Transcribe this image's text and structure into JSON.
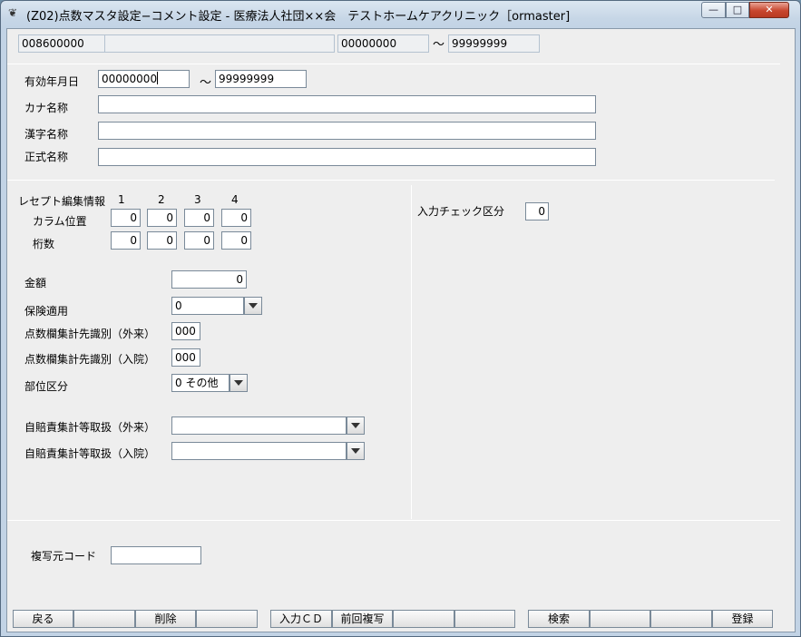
{
  "window": {
    "title": "(Z02)点数マスタ設定−コメント設定 - 医療法人社団××会　テストホームケアクリニック［ormaster]",
    "min_glyph": "—",
    "max_glyph": "□",
    "close_glyph": "✕"
  },
  "header": {
    "code": "008600000",
    "name": "",
    "range_from": "00000000",
    "tilde": "〜",
    "range_to": "99999999"
  },
  "form": {
    "valid_date_label": "有効年月日",
    "valid_from": "00000000",
    "tilde": "〜",
    "valid_to": "99999999",
    "kana_label": "カナ名称",
    "kana_value": "",
    "kanji_label": "漢字名称",
    "kanji_value": "",
    "formal_label": "正式名称",
    "formal_value": ""
  },
  "receipt": {
    "title": "レセプト編集情報",
    "col_headers": [
      "1",
      "2",
      "3",
      "4"
    ],
    "column_pos_label": "カラム位置",
    "column_pos_values": [
      "0",
      "0",
      "0",
      "0"
    ],
    "digits_label": "桁数",
    "digits_values": [
      "0",
      "0",
      "0",
      "0"
    ]
  },
  "details": {
    "amount_label": "金額",
    "amount_value": "0",
    "insurance_label": "保険適用",
    "insurance_value": "0",
    "outpatient_label": "点数欄集計先識別（外来）",
    "outpatient_value": "000",
    "inpatient_label": "点数欄集計先識別（入院）",
    "inpatient_value": "000",
    "part_label": "部位区分",
    "part_value": "0 その他",
    "auto_out_label": "自賠責集計等取扱（外来）",
    "auto_out_value": "",
    "auto_in_label": "自賠責集計等取扱（入院）",
    "auto_in_value": ""
  },
  "right_panel": {
    "input_check_label": "入力チェック区分",
    "input_check_value": "0"
  },
  "copy": {
    "label": "複写元コード",
    "value": ""
  },
  "fkeys": [
    "戻る",
    "",
    "削除",
    "",
    "入力ＣＤ",
    "前回複写",
    "",
    "",
    "検索",
    "",
    "",
    "登録"
  ]
}
